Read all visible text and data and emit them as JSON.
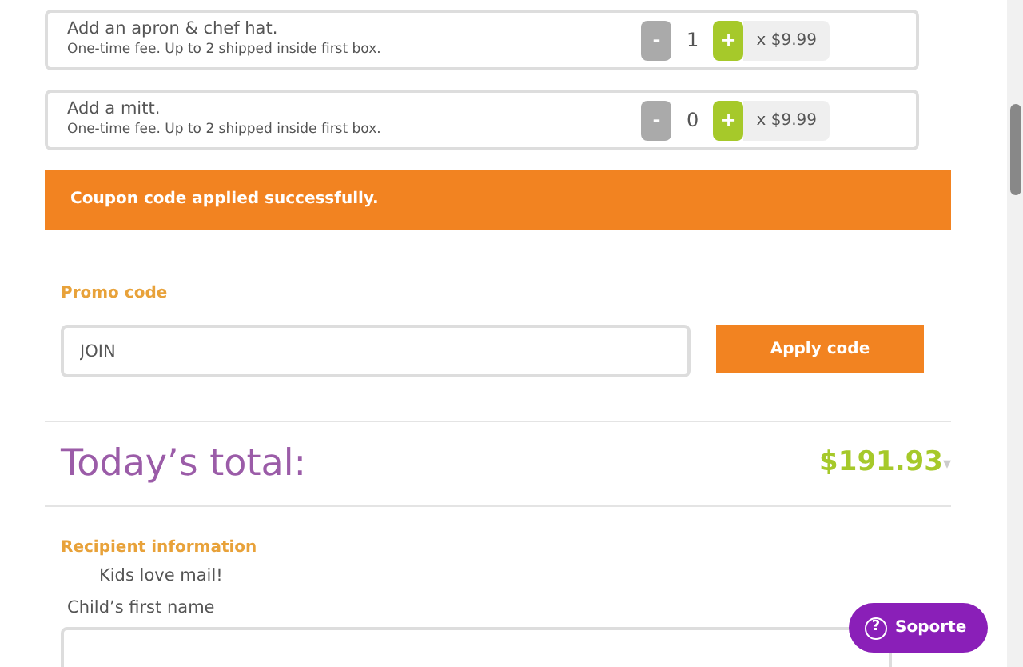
{
  "addons": [
    {
      "title": "Add an apron & chef hat.",
      "note": "One-time fee. Up to 2 shipped inside first box.",
      "minus": "-",
      "quantity": "1",
      "plus": "+",
      "price": "x $9.99"
    },
    {
      "title": "Add a mitt.",
      "note": "One-time fee. Up to 2 shipped inside first box.",
      "minus": "-",
      "quantity": "0",
      "plus": "+",
      "price": "x $9.99"
    }
  ],
  "alert": "Coupon code applied successfully.",
  "promo": {
    "label": "Promo code",
    "value": "JOIN",
    "button": "Apply code"
  },
  "total": {
    "label": "Today’s total:",
    "amount": "$191.93",
    "caret": "▾"
  },
  "recipient": {
    "heading": "Recipient information",
    "tagline": "Kids love mail!",
    "field_label": "Child’s first name"
  },
  "support": {
    "icon": "?",
    "label": "Soporte"
  }
}
